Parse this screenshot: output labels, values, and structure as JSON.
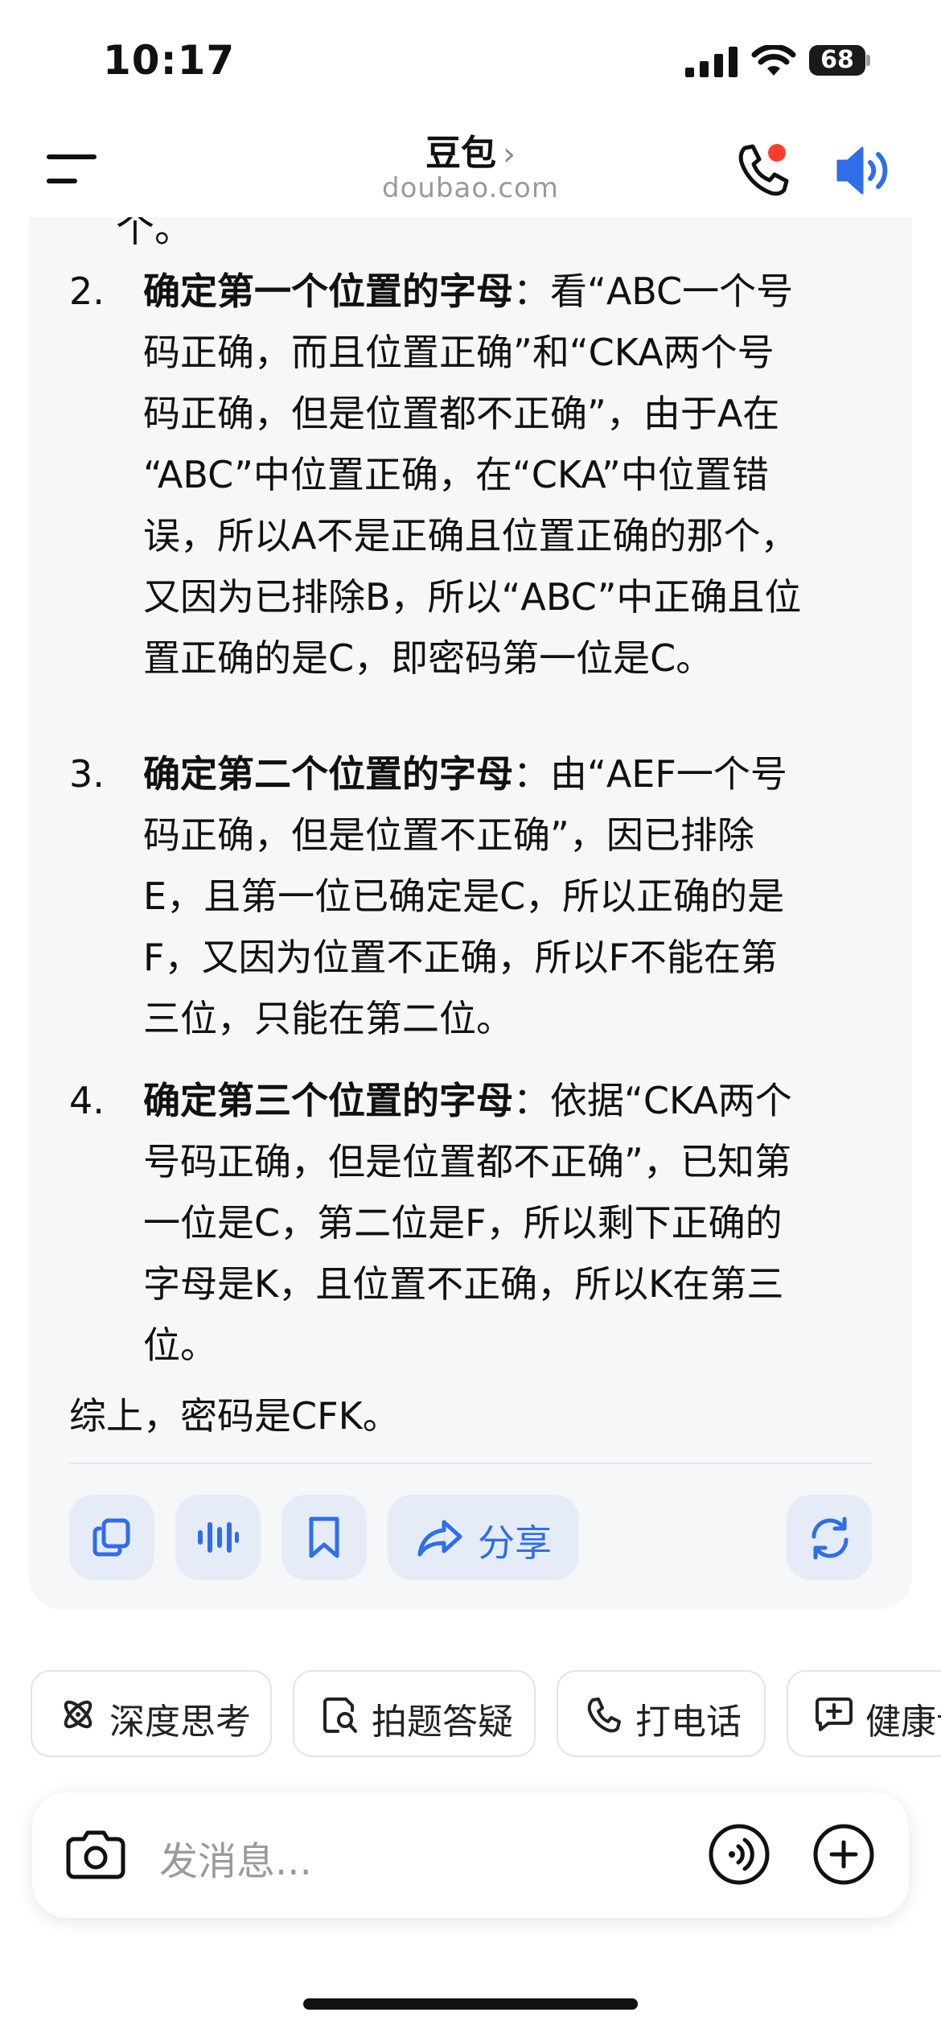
{
  "status": {
    "time": "10:17",
    "battery": "68"
  },
  "header": {
    "title": "豆包",
    "chevron": "›",
    "subtitle": "doubao.com"
  },
  "answer": {
    "cut_off_text": "个。",
    "steps": [
      {
        "num": "2.",
        "heading": "确定第一个位置的字母",
        "lines": [
          "：看“ABC一个号",
          "码正确，而且位置正确”和“CKA两个号",
          "码正确，但是位置都不正确”，由于A在",
          "“ABC”中位置正确，在“CKA”中位置错",
          "误，所以A不是正确且位置正确的那个，",
          "又因为已排除B，所以“ABC”中正确且位",
          "置正确的是C，即密码第一位是C。"
        ]
      },
      {
        "num": "3.",
        "heading": "确定第二个位置的字母",
        "lines": [
          "：由“AEF一个号",
          "码正确，但是位置不正确”，因已排除",
          "E，且第一位已确定是C，所以正确的是",
          "F，又因为位置不正确，所以F不能在第",
          "三位，只能在第二位。"
        ]
      },
      {
        "num": "4.",
        "heading": "确定第三个位置的字母",
        "lines": [
          "：依据“CKA两个",
          "号码正确，但是位置都不正确”，已知第",
          "一位是C，第二位是F，所以剩下正确的",
          "字母是K，且位置不正确，所以K在第三",
          "位。"
        ]
      }
    ],
    "summary": "综上，密码是CFK。",
    "actions": {
      "copy_icon": "copy-icon",
      "voice_icon": "audio-wave-icon",
      "bookmark_icon": "bookmark-icon",
      "share_label": "分享",
      "regenerate_icon": "refresh-icon"
    }
  },
  "chips": [
    {
      "label": "深度思考",
      "icon": "atom-icon"
    },
    {
      "label": "拍题答疑",
      "icon": "photo-search-icon"
    },
    {
      "label": "打电话",
      "icon": "phone-icon"
    },
    {
      "label": "健康诊",
      "icon": "chat-plus-icon"
    }
  ],
  "input": {
    "placeholder": "发消息..."
  },
  "colors": {
    "accent": "#2f6ee8",
    "notification_dot": "#ff3b30",
    "card_bg": "#f6f7f9"
  }
}
